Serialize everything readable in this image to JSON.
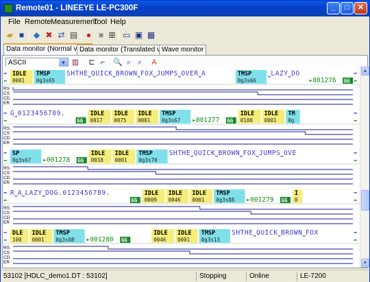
{
  "window": {
    "title": "Remote01 - LINEEYE LE-PC300F"
  },
  "menu": [
    "File",
    "Remote",
    "Measurement",
    "Tool",
    "Help"
  ],
  "tabs": [
    "Data monitor (Normal view)",
    "Data monitor (Translated view)",
    "Wave monitor"
  ],
  "active_tab": 0,
  "code_select": {
    "value": "ASCII"
  },
  "signals": [
    "RS",
    "CS",
    "CD",
    "ER"
  ],
  "colors": {
    "tx_text": "#3a3ad0",
    "idle_bg": "#f5ed7a",
    "tmsp_bg": "#7fe0ea",
    "gg_bg": "#168a2a",
    "line": "#1a1a8c",
    "green": "#128a12"
  },
  "rows": [
    {
      "tokens": [
        {
          "t": "arrow"
        },
        {
          "t": "idle",
          "top": "IDLE",
          "bot": "0001"
        },
        {
          "t": "tmsp",
          "top": "TMSP",
          "bot": "0g3s65"
        },
        {
          "t": "text",
          "v": "SHTHE⎵QUICK⎵BROWN⎵FOX⎵JUMPS⎵OVER⎵A"
        },
        {
          "t": "tmsp",
          "top": "TMSP",
          "bot": "0g3s66"
        },
        {
          "t": "text",
          "v": "⎵LAZY⎵DO"
        },
        {
          "t": "num",
          "v": "001276"
        },
        {
          "t": "gg",
          "v": "GG"
        }
      ],
      "steps": [
        [
          0,
          1
        ],
        [
          0.72,
          1
        ]
      ]
    },
    {
      "tokens": [
        {
          "t": "text",
          "v": "G⎵0123456789."
        },
        {
          "t": "gg",
          "v": "GG"
        },
        {
          "t": "idle",
          "top": "IDLE",
          "bot": "0017"
        },
        {
          "t": "idle",
          "top": "IDLE",
          "bot": "0075"
        },
        {
          "t": "idle",
          "top": "IDLE",
          "bot": "0001"
        },
        {
          "t": "tmsp",
          "top": "TMSP",
          "bot": "0g3s67"
        },
        {
          "t": "num",
          "v": "001277"
        },
        {
          "t": "gg",
          "v": "GG"
        },
        {
          "t": "idle",
          "top": "IDLE",
          "bot": "0100"
        },
        {
          "t": "idle",
          "top": "IDLE",
          "bot": "0001"
        },
        {
          "t": "tmsp",
          "top": "TM",
          "bot": "0g"
        }
      ],
      "steps": [
        [
          0.48,
          1
        ],
        [
          0.86,
          1
        ]
      ]
    },
    {
      "tokens": [
        {
          "t": "tmsp",
          "top": "SP",
          "bot": "0g3s67"
        },
        {
          "t": "num",
          "v": "001278"
        },
        {
          "t": "gg",
          "v": "GG"
        },
        {
          "t": "idle",
          "top": "IDLE",
          "bot": "0018"
        },
        {
          "t": "idle",
          "top": "IDLE",
          "bot": "0001"
        },
        {
          "t": "tmsp",
          "top": "TMSP",
          "bot": "0g3s70"
        },
        {
          "t": "text",
          "v": "SHTHE⎵QUICK⎵BROWN⎵FOX⎵JUMPS⎵OVE"
        }
      ],
      "steps": [
        [
          0.22,
          1
        ],
        [
          0.42,
          1
        ]
      ]
    },
    {
      "tokens": [
        {
          "t": "text",
          "v": "R⎵A⎵LAZY⎵DOG.0123456789."
        },
        {
          "t": "gg",
          "v": "GG"
        },
        {
          "t": "idle",
          "top": "IDLE",
          "bot": "0009"
        },
        {
          "t": "idle",
          "top": "IDLE",
          "bot": "0046"
        },
        {
          "t": "idle",
          "top": "IDLE",
          "bot": "0001"
        },
        {
          "t": "tmsp",
          "top": "TMSP",
          "bot": "0g3s88"
        },
        {
          "t": "num",
          "v": "001279"
        },
        {
          "t": "gg",
          "v": "GG"
        },
        {
          "t": "idle",
          "top": "I",
          "bot": "0"
        }
      ],
      "steps": [
        [
          0.55,
          1
        ],
        [
          0.7,
          1
        ]
      ]
    },
    {
      "tokens": [
        {
          "t": "idle",
          "top": "DLE",
          "bot": "100"
        },
        {
          "t": "idle",
          "top": "IDLE",
          "bot": "0001"
        },
        {
          "t": "tmsp",
          "top": "TMSP",
          "bot": "0g3s08"
        },
        {
          "t": "num",
          "v": "001280"
        },
        {
          "t": "gg",
          "v": "GG"
        },
        {
          "t": "gap"
        },
        {
          "t": "idle",
          "top": "IDLE",
          "bot": "0046"
        },
        {
          "t": "idle",
          "top": "IDLE",
          "bot": "0001"
        },
        {
          "t": "tmsp",
          "top": "TMSP",
          "bot": "0g3s13"
        },
        {
          "t": "text",
          "v": "SHTHE⎵QUICK⎵BROWN⎵FOX"
        }
      ],
      "steps": [
        [
          0.28,
          1
        ],
        [
          0.52,
          1
        ]
      ]
    }
  ],
  "status": {
    "file": "53102 [HDLC_demo1.DT : 53102]",
    "state": "Stopping",
    "conn": "Online",
    "model": "LE-7200"
  }
}
